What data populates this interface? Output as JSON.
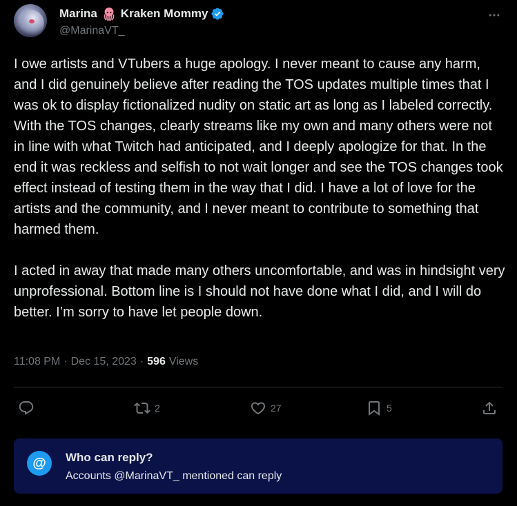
{
  "author": {
    "name": "Marina",
    "name_suffix": "Kraken Mommy",
    "handle": "@MarinaVT_",
    "verified": true,
    "name_emoji_icon": "squid-icon"
  },
  "tweet": {
    "paragraphs": [
      "I owe artists and VTubers a huge apology. I never meant to cause any harm, and I did genuinely believe after reading the TOS updates multiple times that I was ok to display fictionalized nudity on static art as long as I labeled correctly. With the TOS changes, clearly streams like my own and many others were not in line with what Twitch had anticipated, and I deeply apologize for that. In the end it was reckless and selfish to not wait longer and see the TOS changes took effect instead of testing them in the way that I did. I have a lot of love for the artists and the community, and I never meant to contribute to something that harmed them.",
      "I acted in away that made many others uncomfortable, and was in hindsight very unprofessional. Bottom line is I should not have done what I did, and I will do better. I’m sorry to have let people down."
    ],
    "time": "11:08 PM",
    "date": "Dec 15, 2023",
    "views_count": "596",
    "views_label": "Views"
  },
  "actions": {
    "reply_count": "",
    "retweet_count": "2",
    "like_count": "27",
    "bookmark_count": "5"
  },
  "reply_restriction": {
    "title": "Who can reply?",
    "subtitle": "Accounts @MarinaVT_ mentioned can reply"
  },
  "colors": {
    "background": "#000000",
    "text": "#e7e9ea",
    "muted": "#71767b",
    "accent": "#1d9bf0",
    "reply_box": "#0a1248"
  }
}
